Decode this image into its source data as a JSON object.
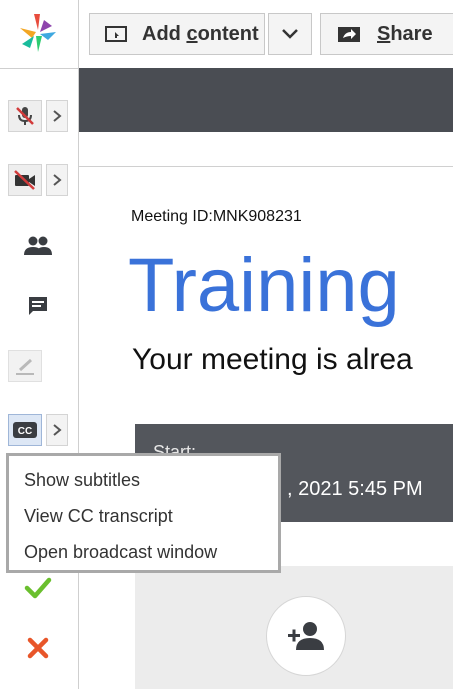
{
  "toolbar": {
    "add_content_label_pre": "Add ",
    "add_content_label_underlined": "c",
    "add_content_label_post": "ontent",
    "share_label_underlined": "S",
    "share_label_post": "hare"
  },
  "meeting": {
    "id_text": "Meeting ID:MNK908231",
    "title": "Training",
    "subtitle": "Your meeting is alrea",
    "start_label": "Start:",
    "start_datetime": ", 2021 5:45 PM"
  },
  "cc_menu": {
    "items": [
      {
        "label": "Show subtitles"
      },
      {
        "label": "View CC transcript"
      },
      {
        "label": "Open broadcast window"
      }
    ]
  },
  "icons": {
    "logo": "app-logo",
    "mic": "mic-off-icon",
    "camera": "camera-off-icon",
    "people": "people-icon",
    "chat": "chat-icon",
    "pen": "pen-icon",
    "cc": "closed-captions-icon",
    "check": "check-icon",
    "cross": "cross-icon",
    "add_user": "add-user-icon"
  },
  "colors": {
    "accent_blue": "#3a72d9",
    "dark_panel": "#4a4d53",
    "check_green": "#6abf2e",
    "cross_orange": "#e8562a",
    "mute_red": "#d23b3b"
  }
}
